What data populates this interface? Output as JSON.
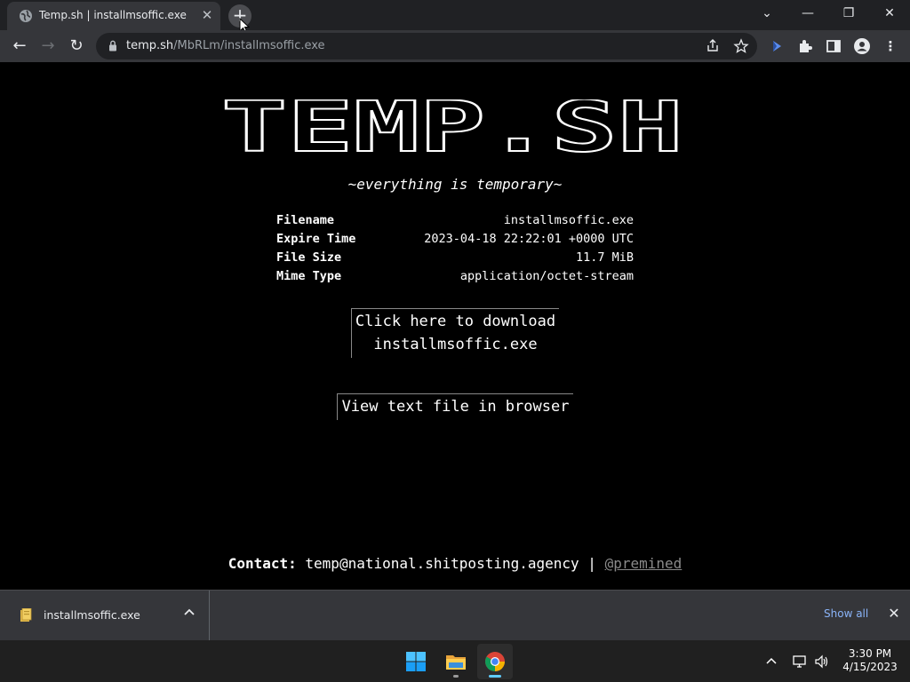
{
  "browser": {
    "tab": {
      "title": "Temp.sh | installmsoffic.exe",
      "close": "✕"
    },
    "new_tab": "+",
    "window_controls": {
      "tab_search": "⌄",
      "minimize": "—",
      "restore": "❐",
      "close": "✕"
    },
    "nav": {
      "back": "←",
      "forward": "→",
      "reload": "↻"
    },
    "address": {
      "host": "temp.sh",
      "path": "/MbRLm/installmsoffic.exe"
    }
  },
  "page": {
    "logo_text": "TEMP.SH",
    "tagline": "~everything is temporary~",
    "file_info": [
      {
        "key": "Filename",
        "value": "installmsoffic.exe"
      },
      {
        "key": "Expire Time",
        "value": "2023-04-18 22:22:01 +0000 UTC"
      },
      {
        "key": "File Size",
        "value": "11.7 MiB"
      },
      {
        "key": "Mime Type",
        "value": "application/octet-stream"
      }
    ],
    "download_button": {
      "line1": "Click here to download",
      "line2": "installmsoffic.exe"
    },
    "view_button": "View text file in browser",
    "contact": {
      "label": "Contact:",
      "email": "temp@national.shitposting.agency",
      "separator": "|",
      "handle": "@premined"
    }
  },
  "download_shelf": {
    "filename": "installmsoffic.exe",
    "show_all": "Show all"
  },
  "taskbar": {
    "clock_time": "3:30 PM",
    "clock_date": "4/15/2023"
  },
  "colors": {
    "page_bg": "#000000",
    "toolbar_bg": "#35363a",
    "titlebar_bg": "#202124",
    "link_blue": "#8ab4f8",
    "taskbar_bg": "#202020"
  }
}
